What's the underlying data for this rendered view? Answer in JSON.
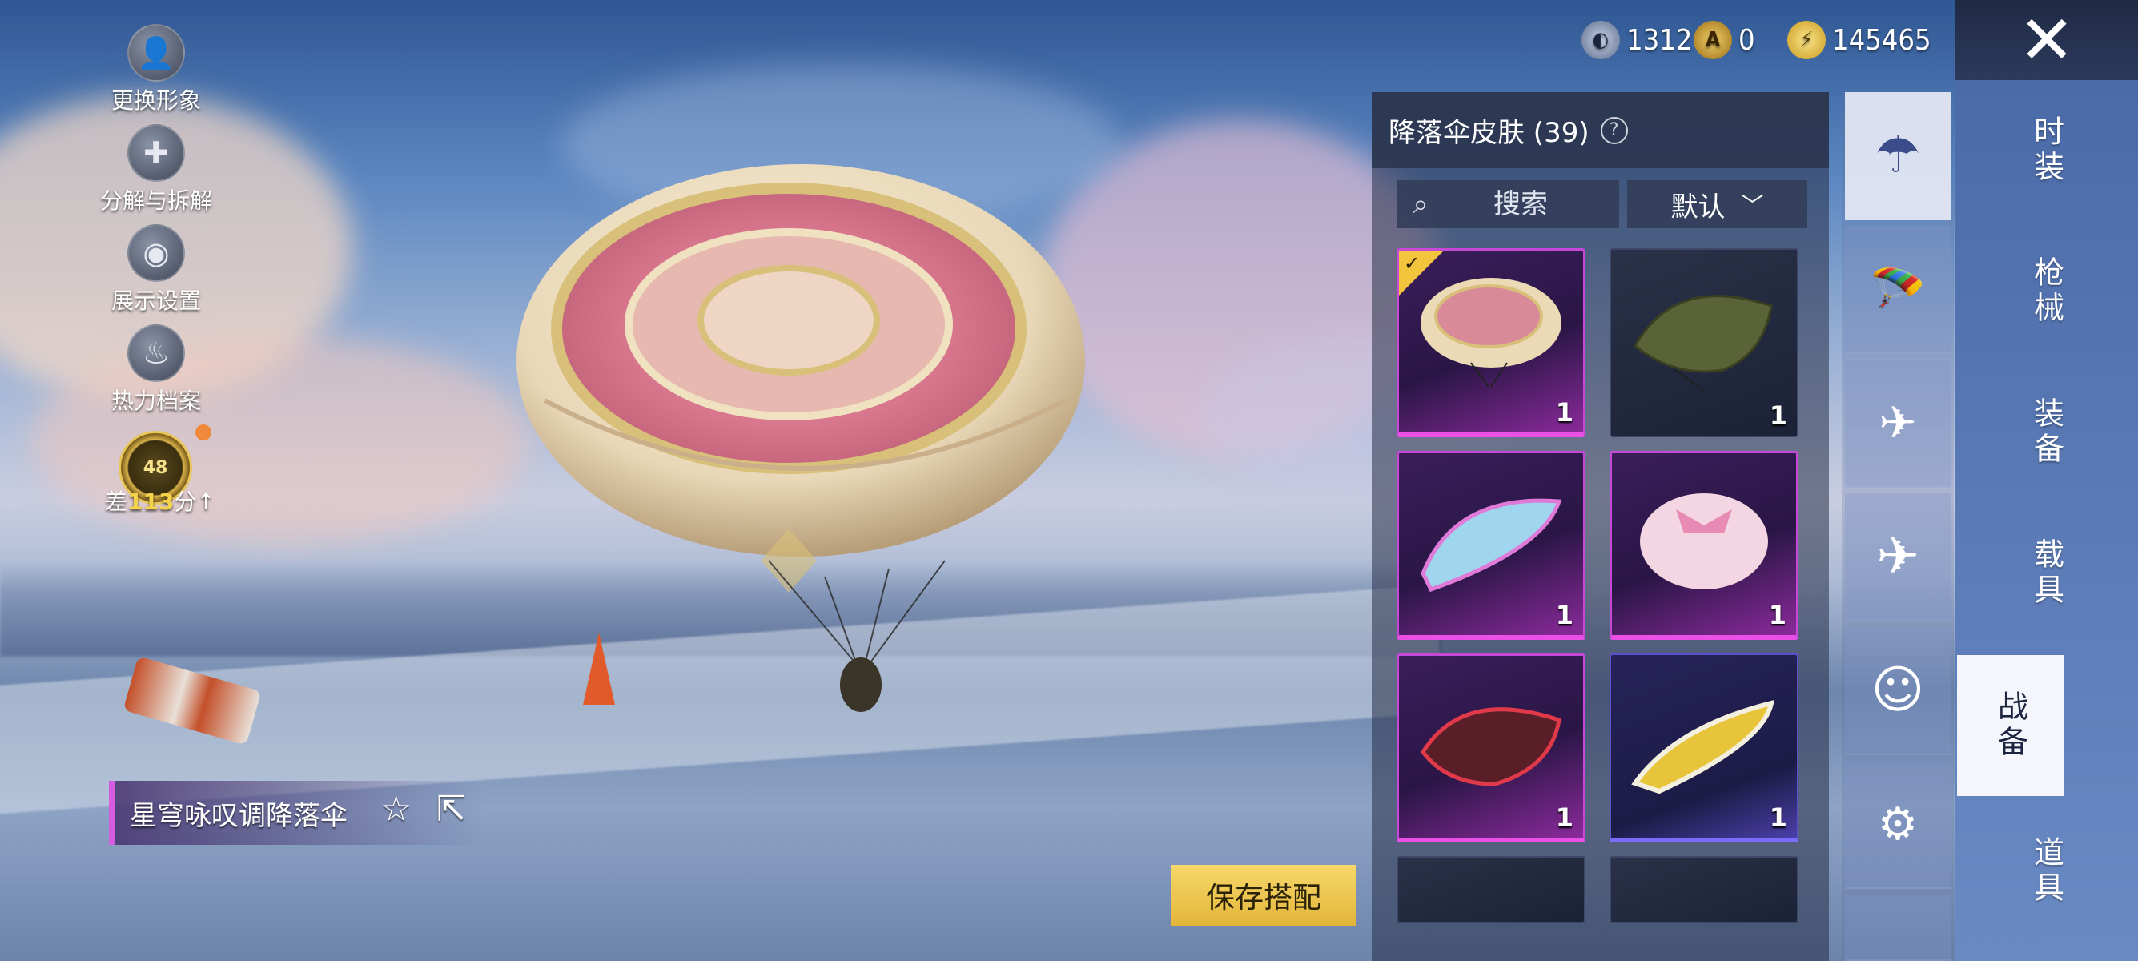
{
  "left_menu": [
    {
      "label": "更换形象",
      "icon": "avatar-icon"
    },
    {
      "label": "分解与拆解",
      "icon": "puzzle-icon"
    },
    {
      "label": "展示设置",
      "icon": "eye-icon"
    },
    {
      "label": "热力档案",
      "icon": "flame-icon"
    }
  ],
  "rank": {
    "level": "48",
    "text_prefix": "差",
    "points": "113",
    "text_suffix": "分",
    "arrow": "↑"
  },
  "currency": [
    {
      "value": "1312",
      "icon": "silver-coin-icon",
      "color": "#7a8aa8"
    },
    {
      "value": "0",
      "icon": "gold-token-icon",
      "color": "#d9a62a"
    },
    {
      "value": "145465",
      "icon": "bp-coin-icon",
      "color": "#e8c43a"
    }
  ],
  "close_glyph": "✕",
  "panel": {
    "title": "降落伞皮肤 (39)",
    "help": "?",
    "search_placeholder": "搜索",
    "sort_label": "默认",
    "items": [
      {
        "count": "1",
        "rarity": "purple",
        "selected": true
      },
      {
        "count": "1",
        "rarity": "dark",
        "selected": false
      },
      {
        "count": "1",
        "rarity": "purple",
        "selected": false
      },
      {
        "count": "1",
        "rarity": "purple",
        "selected": false
      },
      {
        "count": "1",
        "rarity": "purple",
        "selected": false
      },
      {
        "count": "1",
        "rarity": "blue",
        "selected": false
      }
    ]
  },
  "type_tabs": [
    "parachute-icon",
    "skydive-icon",
    "drone-icon",
    "plane-icon",
    "emote-icon",
    "robot-icon"
  ],
  "categories": [
    "时装",
    "枪械",
    "装备",
    "载具",
    "战备",
    "道具"
  ],
  "active_category": "战备",
  "item_name": "星穹咏叹调降落伞",
  "save_button": "保存搭配"
}
